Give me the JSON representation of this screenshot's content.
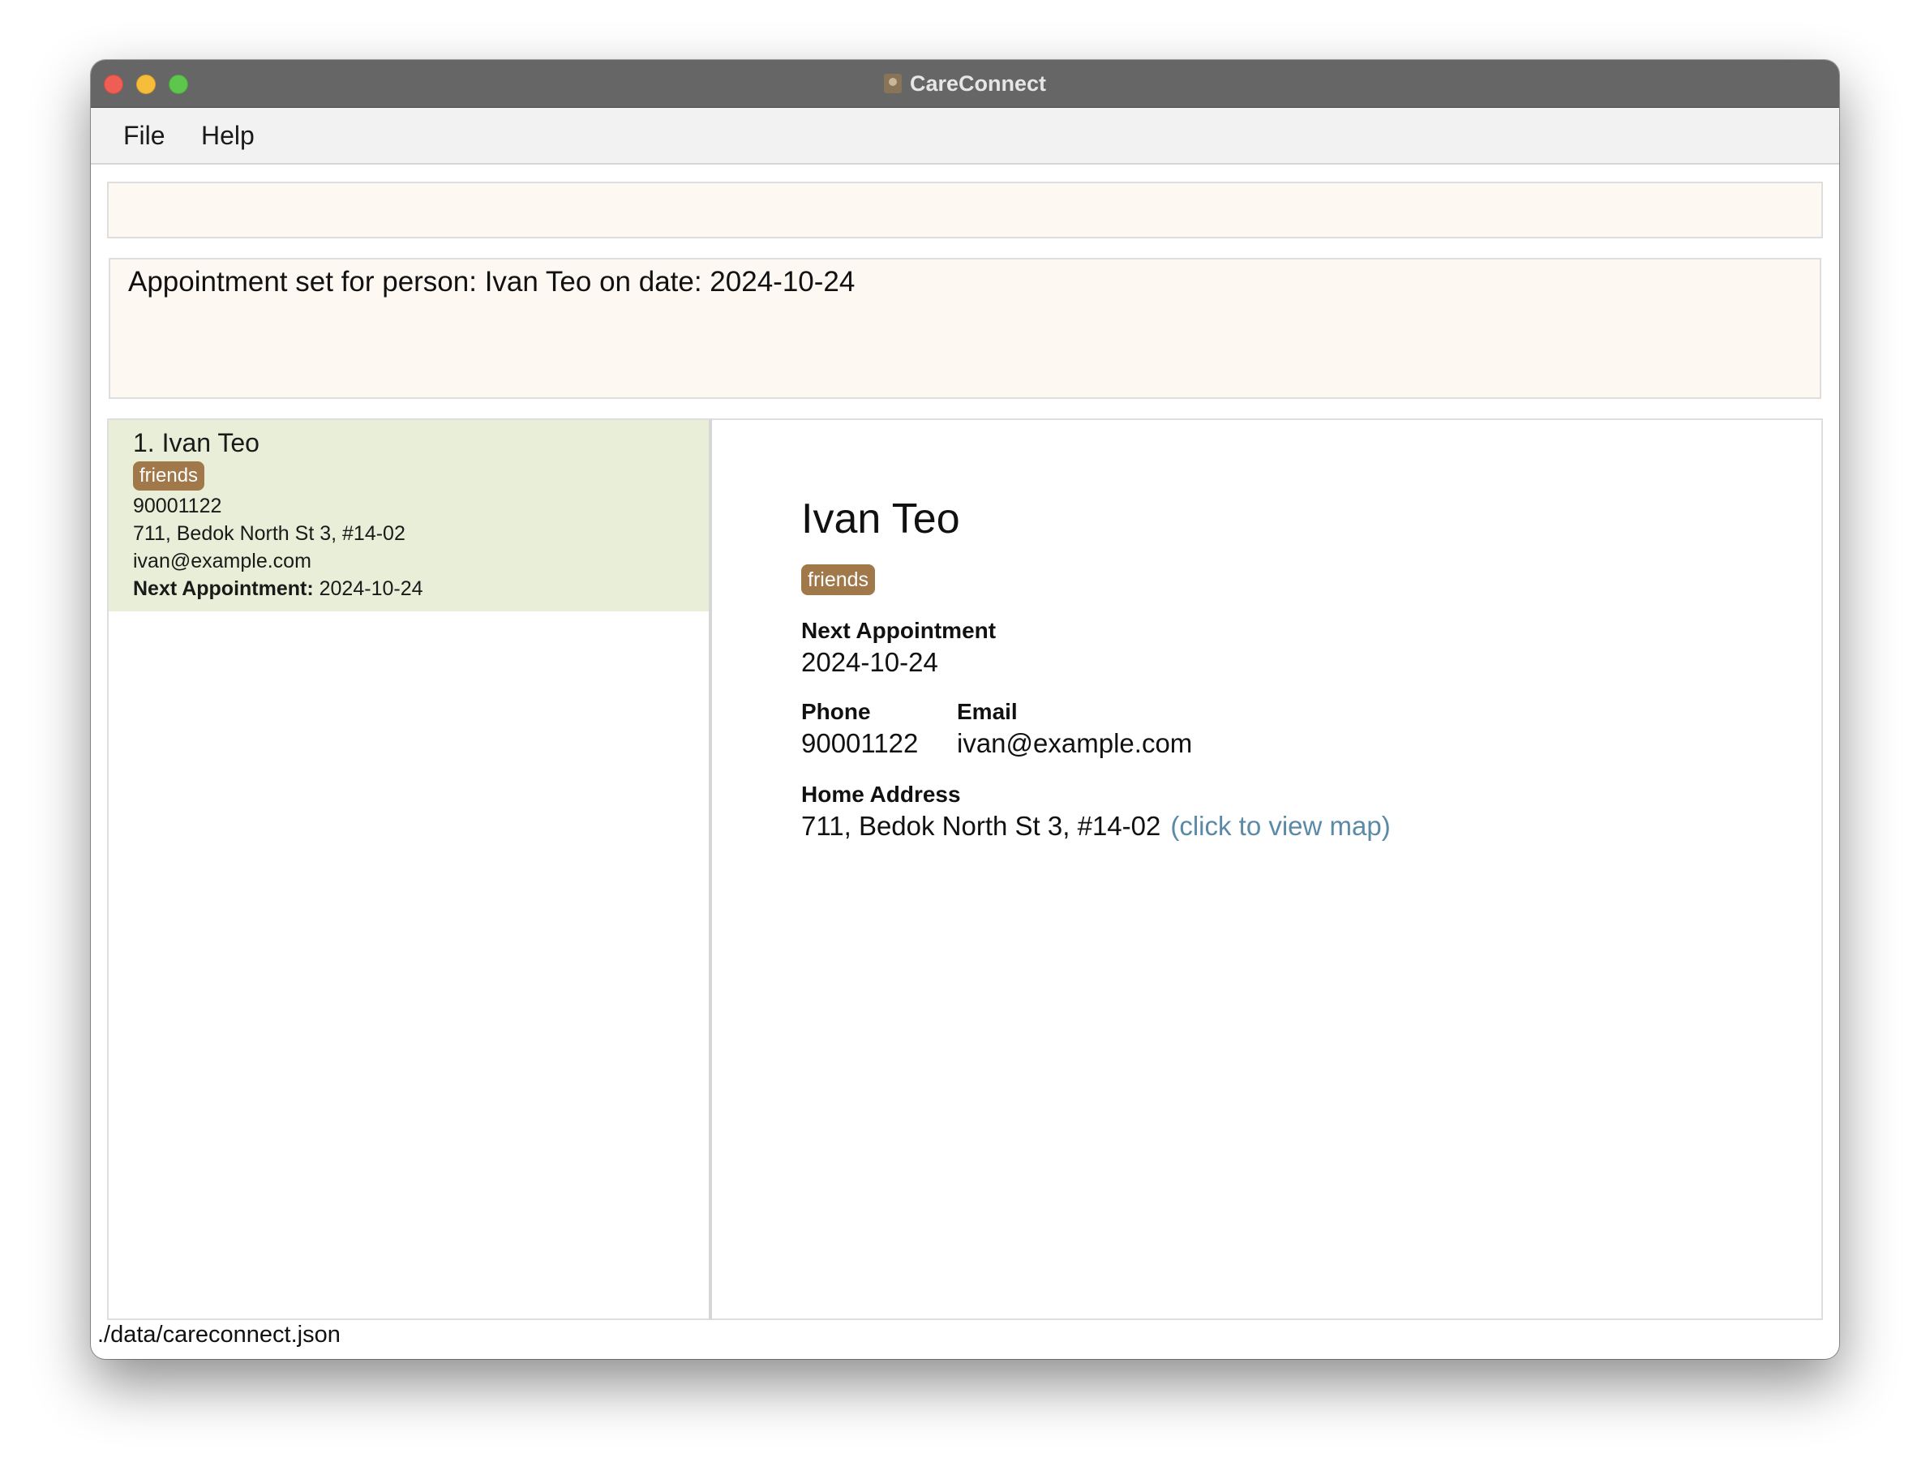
{
  "window": {
    "title": "CareConnect"
  },
  "menu": {
    "file": "File",
    "help": "Help"
  },
  "command": {
    "value": ""
  },
  "result": {
    "message": "Appointment set for person: Ivan Teo on date: 2024-10-24"
  },
  "person_list": [
    {
      "index_name": "1. Ivan Teo",
      "tag": "friends",
      "phone": "90001122",
      "address": "711, Bedok North St 3, #14-02",
      "email": "ivan@example.com",
      "appointment_label": "Next Appointment:",
      "appointment_value": "2024-10-24",
      "selected": true
    }
  ],
  "detail": {
    "name": "Ivan Teo",
    "tag": "friends",
    "appointment_label": "Next Appointment",
    "appointment_value": "2024-10-24",
    "phone_label": "Phone",
    "phone_value": "90001122",
    "email_label": "Email",
    "email_value": "ivan@example.com",
    "address_label": "Home Address",
    "address_value": "711, Bedok North St 3, #14-02",
    "map_link": "(click to view map)"
  },
  "status": {
    "file_path": "./data/careconnect.json"
  },
  "colors": {
    "titlebar": "#666666",
    "selected_card": "#e8eed7",
    "tag": "#a0784a",
    "input_background": "#fdf8f2",
    "link": "#5a8aa6"
  }
}
